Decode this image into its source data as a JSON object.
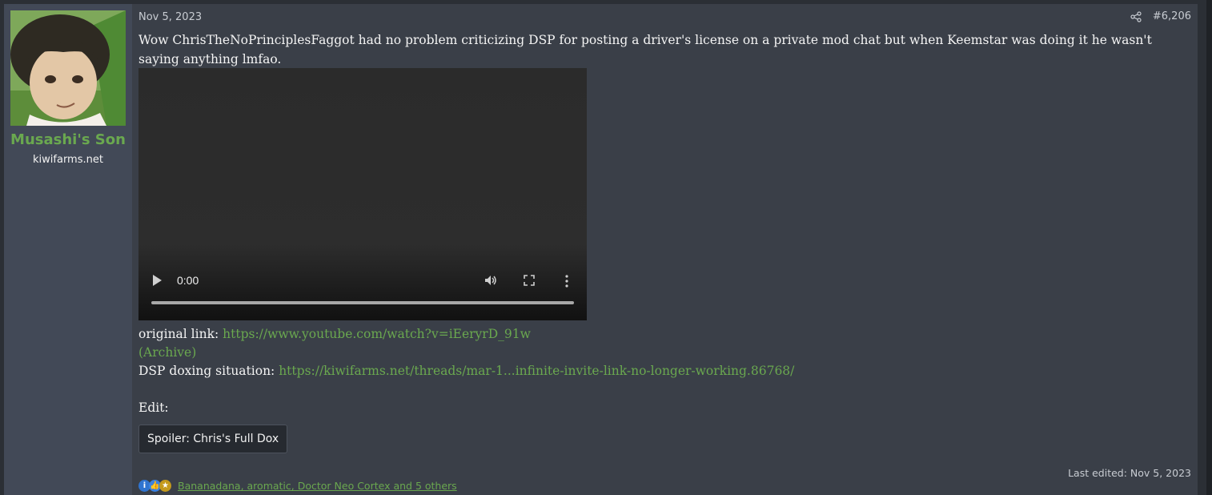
{
  "user": {
    "name": "Musashi's Son",
    "title": "kiwifarms.net"
  },
  "post": {
    "date": "Nov 5, 2023",
    "number": "#6,206",
    "body": "Wow ChrisTheNoPrinciplesFaggot had no problem criticizing DSP for posting a driver's license on a private mod chat but when Keemstar was doing it he wasn't saying anything lmfao.",
    "video": {
      "time": "0:00"
    },
    "links": {
      "original_label": "original link: ",
      "original_url": "https://www.youtube.com/watch?v=iEeryrD_91w",
      "archive_label": "(Archive)",
      "dsp_label": "DSP doxing situation: ",
      "dsp_url": "https://kiwifarms.net/threads/mar-1...infinite-invite-link-no-longer-working.86768/",
      "edit_label": "Edit:"
    },
    "spoiler_label": "Spoiler: Chris's Full Dox",
    "last_edited": "Last edited: Nov 5, 2023",
    "reactions": {
      "icons": [
        "informative-icon",
        "like-icon",
        "winner-icon"
      ],
      "text": "Bananadana, aromatic, Doctor Neo Cortex and 5 others"
    }
  },
  "colors": {
    "link": "#6aa84f",
    "username": "#6aa84f",
    "post_bg": "#3a3f48",
    "user_cell_bg": "#424957"
  }
}
